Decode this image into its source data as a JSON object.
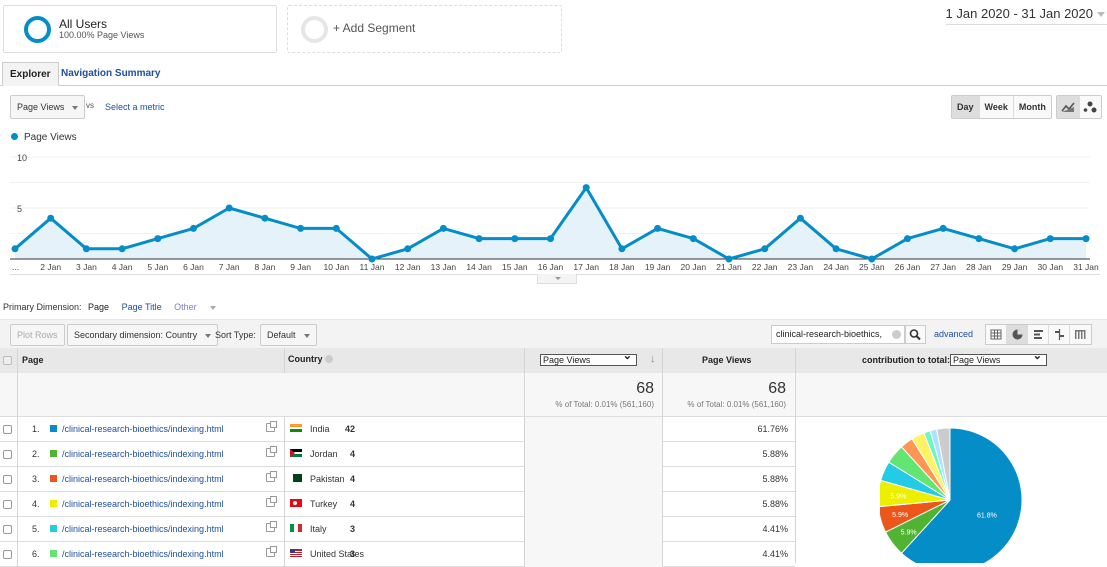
{
  "segments": [
    {
      "title": "All Users",
      "subtitle": "100.00% Page Views"
    },
    {
      "title": "+ Add Segment",
      "subtitle": ""
    }
  ],
  "date_range": "1 Jan 2020 - 31 Jan 2020",
  "tabs": [
    {
      "label": "Explorer",
      "active": true
    },
    {
      "label": "Navigation Summary",
      "active": false
    }
  ],
  "metric": {
    "selected": "Page Views",
    "vs_label": "vs",
    "compare_link": "Select a metric"
  },
  "granularity": [
    {
      "label": "Day",
      "active": true
    },
    {
      "label": "Week",
      "active": false
    },
    {
      "label": "Month",
      "active": false
    }
  ],
  "chart_type_icons": [
    "line-chart-icon",
    "motion-chart-icon"
  ],
  "chart_data": {
    "type": "area",
    "legend": [
      "Page Views"
    ],
    "series": [
      {
        "name": "Page Views",
        "color": "#058dc7",
        "values": [
          1,
          4,
          1,
          1,
          2,
          3,
          5,
          4,
          3,
          3,
          0,
          1,
          3,
          2,
          2,
          2,
          7,
          1,
          3,
          2,
          0,
          1,
          4,
          1,
          0,
          2,
          3,
          2,
          1,
          2,
          2
        ]
      }
    ],
    "x": [
      "...",
      "2 Jan",
      "3 Jan",
      "4 Jan",
      "5 Jan",
      "6 Jan",
      "7 Jan",
      "8 Jan",
      "9 Jan",
      "10 Jan",
      "11 Jan",
      "12 Jan",
      "13 Jan",
      "14 Jan",
      "15 Jan",
      "16 Jan",
      "17 Jan",
      "18 Jan",
      "19 Jan",
      "20 Jan",
      "21 Jan",
      "22 Jan",
      "23 Jan",
      "24 Jan",
      "25 Jan",
      "26 Jan",
      "27 Jan",
      "28 Jan",
      "29 Jan",
      "30 Jan",
      "31 Jan"
    ],
    "yticks": [
      5,
      10
    ],
    "ylim": [
      0,
      10
    ],
    "grid": true,
    "legend_position": "top-left"
  },
  "primary_dimension": {
    "label": "Primary Dimension:",
    "current": "Page",
    "options": [
      "Page Title",
      "Other"
    ]
  },
  "toolbar": {
    "plot_rows": "Plot Rows",
    "secondary_dimension": "Secondary dimension: Country",
    "sort_type_label": "Sort Type:",
    "sort_type_value": "Default",
    "search_value": "clinical-research-bioethics,",
    "advanced": "advanced",
    "view_icons": [
      "table-view-icon",
      "pie-view-icon",
      "performance-view-icon",
      "comparison-view-icon",
      "pivot-view-icon"
    ]
  },
  "table": {
    "headers": {
      "page": "Page",
      "country": "Country",
      "metric_select": "Page Views",
      "metric2": "Page Views",
      "contribution_label": "contribution to total:",
      "contribution_select": "Page Views"
    },
    "totals": {
      "value1": "68",
      "sub1": "% of Total: 0.01% (561,160)",
      "value2": "68",
      "sub2": "% of Total: 0.01% (561,160)"
    },
    "rows": [
      {
        "idx": "1.",
        "page": "/clinical-research-bioethics/indexing.html",
        "country": "India",
        "views": "42",
        "pct": "61.76%",
        "color": "#058dc7"
      },
      {
        "idx": "2.",
        "page": "/clinical-research-bioethics/indexing.html",
        "country": "Jordan",
        "views": "4",
        "pct": "5.88%",
        "color": "#50b432"
      },
      {
        "idx": "3.",
        "page": "/clinical-research-bioethics/indexing.html",
        "country": "Pakistan",
        "views": "4",
        "pct": "5.88%",
        "color": "#ed561b"
      },
      {
        "idx": "4.",
        "page": "/clinical-research-bioethics/indexing.html",
        "country": "Turkey",
        "views": "4",
        "pct": "5.88%",
        "color": "#edef00"
      },
      {
        "idx": "5.",
        "page": "/clinical-research-bioethics/indexing.html",
        "country": "Italy",
        "views": "3",
        "pct": "4.41%",
        "color": "#24cbe5"
      },
      {
        "idx": "6.",
        "page": "/clinical-research-bioethics/indexing.html",
        "country": "United States",
        "views": "3",
        "pct": "4.41%",
        "color": "#64e572"
      }
    ]
  },
  "pie": {
    "slices": [
      {
        "value": 61.76,
        "color": "#058dc7",
        "label": "61.8%"
      },
      {
        "value": 5.88,
        "color": "#50b432",
        "label": "5.9%"
      },
      {
        "value": 5.88,
        "color": "#ed561b",
        "label": "5.9%"
      },
      {
        "value": 5.88,
        "color": "#edef00",
        "label": "5.9%"
      },
      {
        "value": 4.41,
        "color": "#24cbe5",
        "label": ""
      },
      {
        "value": 4.41,
        "color": "#64e572",
        "label": ""
      },
      {
        "value": 2.94,
        "color": "#ff9655",
        "label": ""
      },
      {
        "value": 2.94,
        "color": "#fff263",
        "label": ""
      },
      {
        "value": 1.47,
        "color": "#6af9c4",
        "label": ""
      },
      {
        "value": 1.47,
        "color": "#b2deff",
        "label": ""
      },
      {
        "value": 2.96,
        "color": "#cccccc",
        "label": ""
      }
    ]
  }
}
